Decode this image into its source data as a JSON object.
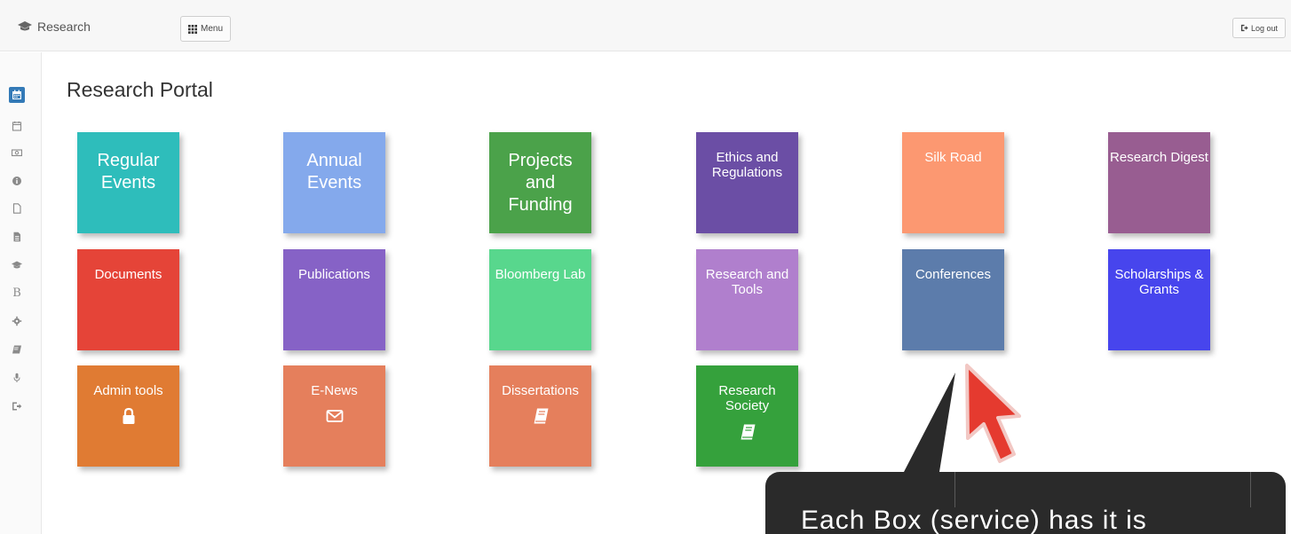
{
  "topbar": {
    "brand": "Research",
    "menu_label": "Menu",
    "logout_label": "Log out"
  },
  "sidebar": {
    "items": [
      {
        "icon": "calendar-icon",
        "active": true
      },
      {
        "icon": "calendar-outline-icon"
      },
      {
        "icon": "money-icon"
      },
      {
        "icon": "info-icon"
      },
      {
        "icon": "file-outline-icon"
      },
      {
        "icon": "file-text-icon"
      },
      {
        "icon": "graduation-cap-icon"
      },
      {
        "icon": "bold-b-icon",
        "glyph": "B"
      },
      {
        "icon": "cog-icon"
      },
      {
        "icon": "book-icon"
      },
      {
        "icon": "microphone-icon"
      },
      {
        "icon": "sign-out-icon"
      }
    ]
  },
  "main": {
    "title": "Research Portal",
    "tiles": [
      {
        "label": "Regular Events",
        "color": "#2ebdbb",
        "size": "big"
      },
      {
        "label": "Annual Events",
        "color": "#84a9ec",
        "size": "big"
      },
      {
        "label": "Projects and Funding",
        "color": "#4ba24a",
        "size": "big"
      },
      {
        "label": "Ethics and Regulations",
        "color": "#6b4ea5",
        "size": "small"
      },
      {
        "label": "Silk Road",
        "color": "#fc9871",
        "size": "small"
      },
      {
        "label": "Research Digest",
        "color": "#985d91",
        "size": "small"
      },
      {
        "label": "Documents",
        "color": "#e54438",
        "size": "small"
      },
      {
        "label": "Publications",
        "color": "#8662c6",
        "size": "small"
      },
      {
        "label": "Bloomberg Lab",
        "color": "#58d78d",
        "size": "small"
      },
      {
        "label": "Research and Tools",
        "color": "#b07fcd",
        "size": "small"
      },
      {
        "label": "Conferences",
        "color": "#5c7cab",
        "size": "small"
      },
      {
        "label": "Scholarships & Grants",
        "color": "#4745ed",
        "size": "small"
      },
      {
        "label": "Admin tools",
        "color": "#e07b33",
        "size": "small",
        "icon": "lock-icon"
      },
      {
        "label": "E-News",
        "color": "#e57f5c",
        "size": "small",
        "icon": "envelope-icon"
      },
      {
        "label": "Dissertations",
        "color": "#e57f5c",
        "size": "small",
        "icon": "book-icon"
      },
      {
        "label": "Research Society",
        "color": "#35a13c",
        "size": "small",
        "icon": "book-icon"
      }
    ]
  },
  "callout": {
    "text": "Each Box (service) has it is"
  },
  "colors": {
    "active_sidebar": "#337ab7",
    "pointer_arrow": "#e53a2f",
    "callout_bg": "#2a2a2a"
  }
}
